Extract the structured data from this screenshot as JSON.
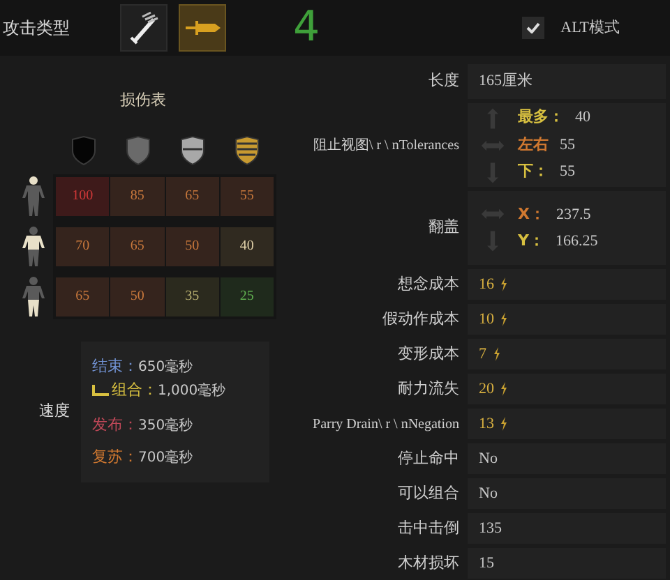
{
  "top_bar": {
    "label": "攻击类型",
    "attack_types": [
      {
        "selected": false
      },
      {
        "selected": true
      }
    ],
    "count": "4",
    "alt_mode": {
      "label": "ALT模式",
      "checked": true
    }
  },
  "damage_table": {
    "title": "损伤表",
    "rows": [
      {
        "cells": [
          {
            "value": "100",
            "kind": "high"
          },
          {
            "value": "85",
            "kind": "mid"
          },
          {
            "value": "65",
            "kind": "mid"
          },
          {
            "value": "55",
            "kind": "mid"
          }
        ]
      },
      {
        "cells": [
          {
            "value": "70",
            "kind": "mid"
          },
          {
            "value": "65",
            "kind": "mid"
          },
          {
            "value": "50",
            "kind": "mid"
          },
          {
            "value": "40",
            "kind": "neutral"
          }
        ]
      },
      {
        "cells": [
          {
            "value": "65",
            "kind": "mid"
          },
          {
            "value": "50",
            "kind": "mid"
          },
          {
            "value": "35",
            "kind": "low"
          },
          {
            "value": "25",
            "kind": "lowest"
          }
        ]
      }
    ]
  },
  "speed": {
    "label": "速度",
    "entries": [
      {
        "label": "结束：",
        "value": "650毫秒",
        "color": "#7090d0",
        "kind": "plain"
      },
      {
        "label": "组合：",
        "value": "1,000毫秒",
        "color": "#d8c040",
        "kind": "combo"
      },
      {
        "label": "发布：",
        "value": "350毫秒",
        "color": "#c04858",
        "kind": "plain"
      },
      {
        "label": "复苏：",
        "value": "700毫秒",
        "color": "#d07830",
        "kind": "plain"
      }
    ]
  },
  "stats": [
    {
      "kind": "text",
      "label": "长度",
      "value": "165厘米"
    },
    {
      "kind": "tolerances",
      "label": "阻止视图\\ r \\ nTolerances",
      "items": [
        {
          "label": "最多：",
          "value": "40",
          "color": "#d8c040"
        },
        {
          "label": "左右",
          "value": "55",
          "color": "#d07830"
        },
        {
          "label": "下：",
          "value": "55",
          "color": "#d8c040"
        }
      ]
    },
    {
      "kind": "tolerances",
      "label": "翻盖",
      "items": [
        {
          "label": "X：",
          "value": "237.5",
          "color": "#d07830"
        },
        {
          "label": "Y：",
          "value": "166.25",
          "color": "#d8c040"
        }
      ]
    },
    {
      "kind": "cost",
      "label": "想念成本",
      "value": "16"
    },
    {
      "kind": "cost",
      "label": "假动作成本",
      "value": "10"
    },
    {
      "kind": "cost",
      "label": "变形成本",
      "value": "7"
    },
    {
      "kind": "cost",
      "label": "耐力流失",
      "value": "20"
    },
    {
      "kind": "cost",
      "label": "Parry Drain\\ r \\ nNegation",
      "value": "13"
    },
    {
      "kind": "text",
      "label": "停止命中",
      "value": "No"
    },
    {
      "kind": "text",
      "label": "可以组合",
      "value": "No"
    },
    {
      "kind": "text",
      "label": "击中击倒",
      "value": "135"
    },
    {
      "kind": "text",
      "label": "木材损坏",
      "value": "15"
    }
  ]
}
